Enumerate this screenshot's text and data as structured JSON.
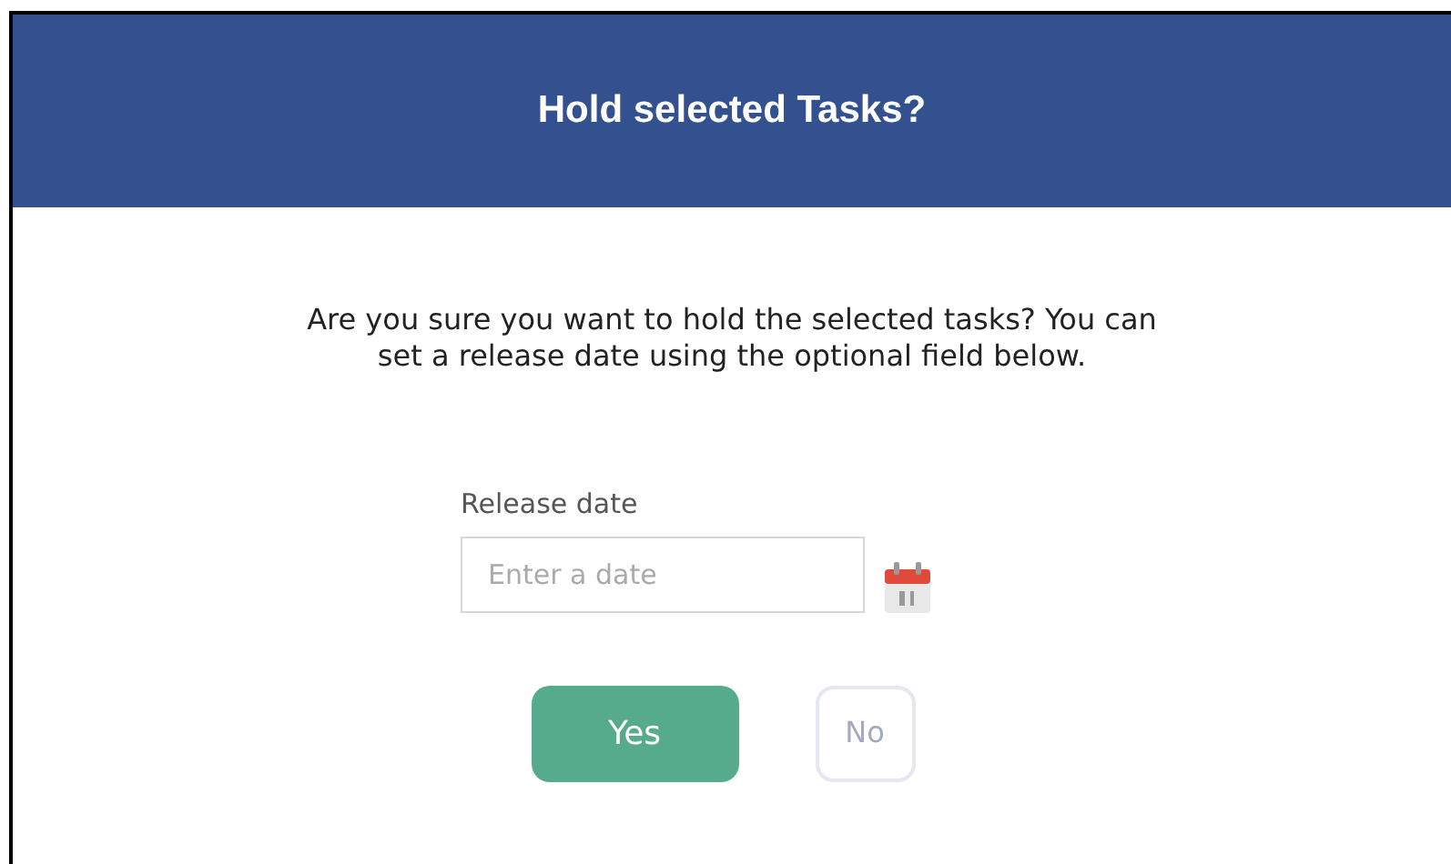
{
  "dialog": {
    "title": "Hold selected Tasks?",
    "message": "Are you sure you want to hold the selected tasks? You can set a release date using the optional field below.",
    "release_date": {
      "label": "Release date",
      "placeholder": "Enter a date"
    },
    "buttons": [
      {
        "label": "Yes",
        "kind": "primary"
      },
      {
        "label": "No",
        "kind": "secondary"
      }
    ]
  }
}
